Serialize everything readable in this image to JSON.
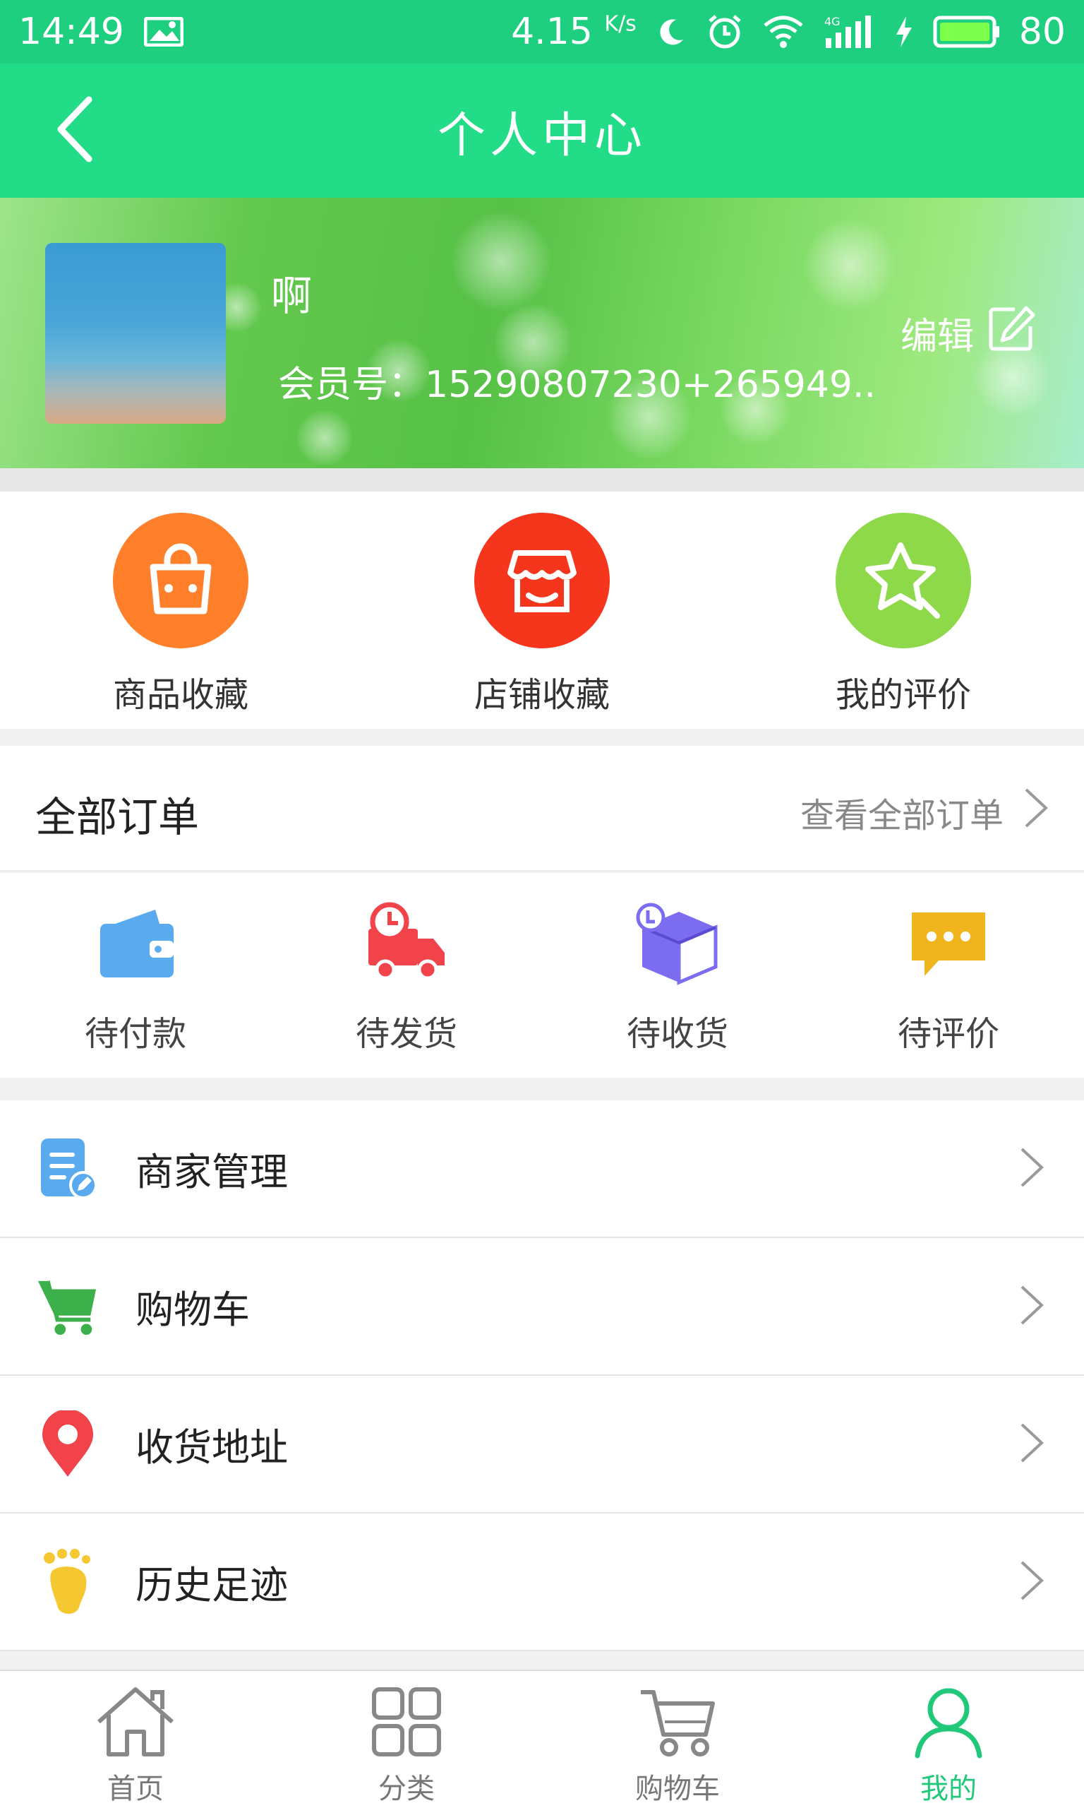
{
  "status_bar": {
    "time": "14:49",
    "net_speed": "4.15",
    "net_unit": "K/s",
    "battery": "80",
    "signal": "4G"
  },
  "header": {
    "title": "个人中心"
  },
  "profile": {
    "nickname": "啊",
    "member_id": "会员号：15290807230+265949..",
    "edit_label": "编辑"
  },
  "favorites": [
    {
      "label": "商品收藏",
      "icon": "shopping-bag-icon",
      "color": "#ff7f2a"
    },
    {
      "label": "店铺收藏",
      "icon": "store-icon",
      "color": "#f5361c"
    },
    {
      "label": "我的评价",
      "icon": "star-search-icon",
      "color": "#8ed94a"
    }
  ],
  "orders": {
    "title": "全部订单",
    "view_all": "查看全部订单",
    "items": [
      {
        "label": "待付款",
        "icon": "wallet-icon",
        "color": "#5aaaf0"
      },
      {
        "label": "待发货",
        "icon": "delivery-truck-icon",
        "color": "#f2434b"
      },
      {
        "label": "待收货",
        "icon": "package-box-icon",
        "color": "#7b6cf0"
      },
      {
        "label": "待评价",
        "icon": "chat-bubble-icon",
        "color": "#f0b41c"
      }
    ]
  },
  "menu": [
    {
      "label": "商家管理",
      "icon": "document-edit-icon",
      "color": "#5aaaf0"
    },
    {
      "label": "购物车",
      "icon": "shopping-cart-icon",
      "color": "#3cb04a"
    },
    {
      "label": "收货地址",
      "icon": "location-pin-icon",
      "color": "#f2434b"
    },
    {
      "label": "历史足迹",
      "icon": "footprint-icon",
      "color": "#f5c832"
    }
  ],
  "bottom_nav": [
    {
      "label": "首页",
      "icon": "home-icon",
      "active": false
    },
    {
      "label": "分类",
      "icon": "grid-icon",
      "active": false
    },
    {
      "label": "购物车",
      "icon": "cart-icon",
      "active": false
    },
    {
      "label": "我的",
      "icon": "user-icon",
      "active": true
    }
  ],
  "colors": {
    "primary": "#22dc88",
    "status_bar": "#1fcf80",
    "active_tab": "#22c87a"
  }
}
